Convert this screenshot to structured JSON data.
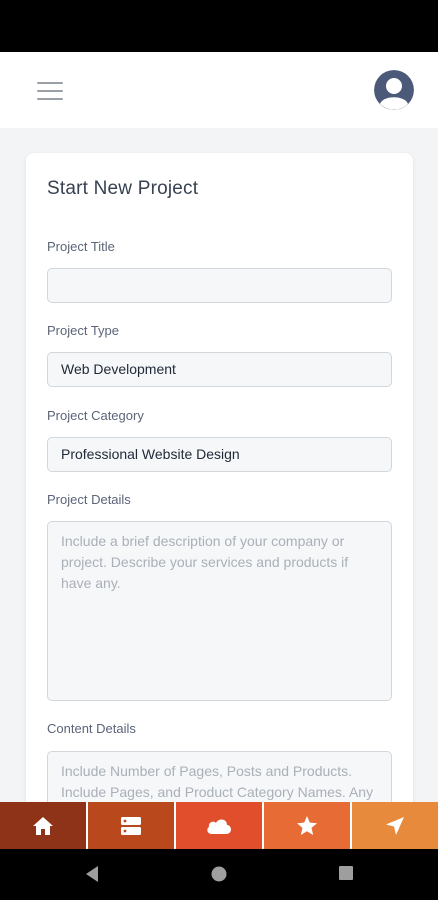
{
  "header": {
    "menu_icon": "hamburger-menu-icon",
    "avatar_icon": "user-avatar-icon"
  },
  "form": {
    "title": "Start New Project",
    "project_title": {
      "label": "Project Title",
      "value": ""
    },
    "project_type": {
      "label": "Project Type",
      "value": "Web Development"
    },
    "project_category": {
      "label": "Project Category",
      "value": "Professional Website Design"
    },
    "project_details": {
      "label": "Project Details",
      "placeholder": "Include a brief description of your company or project. Describe your services and products if have any."
    },
    "content_details": {
      "label": "Content Details",
      "placeholder": "Include Number of Pages, Posts and Products. Include Pages, and Product Category Names. Any"
    }
  },
  "bottom_nav": {
    "items": [
      {
        "icon": "home-icon",
        "color": "#8e3317"
      },
      {
        "icon": "server-icon",
        "color": "#b9491c"
      },
      {
        "icon": "cloud-icon",
        "color": "#e04e2b"
      },
      {
        "icon": "star-icon",
        "color": "#e66b34"
      },
      {
        "icon": "navigation-arrow-icon",
        "color": "#e88a3c"
      }
    ]
  },
  "system_nav": {
    "back_icon": "back-triangle-icon",
    "home_icon": "home-circle-icon",
    "recents_icon": "recents-square-icon"
  }
}
